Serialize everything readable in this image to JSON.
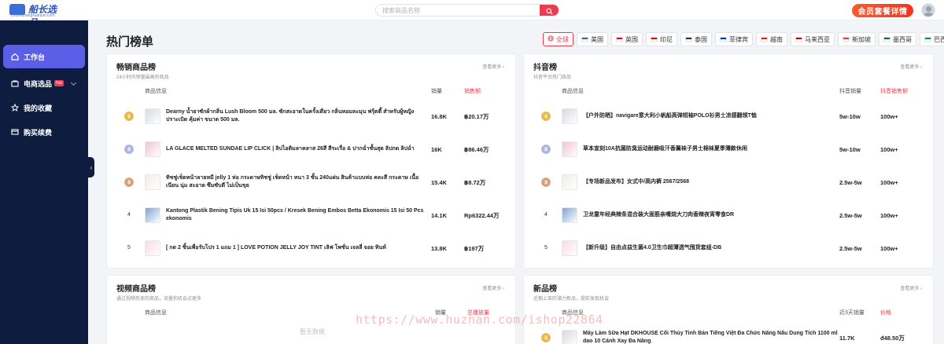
{
  "header": {
    "logo_text": "船长选品",
    "logo_sub": "chuanzhangxuanpin.com",
    "search_placeholder": "搜索商品名称",
    "vip_label": "会员套餐详情"
  },
  "sidebar": {
    "items": [
      {
        "label": "工作台",
        "icon": "home-icon"
      },
      {
        "label": "电商选品",
        "badge": "Hot",
        "icon": "store-icon"
      },
      {
        "label": "我的收藏",
        "icon": "star-icon"
      },
      {
        "label": "购买续费",
        "icon": "card-icon"
      }
    ],
    "collapse_glyph": "‹"
  },
  "page": {
    "title": "热门榜单"
  },
  "regions": [
    {
      "label": "全球",
      "active": true,
      "color": "#888888"
    },
    {
      "label": "美国",
      "color": "#3c5aa6"
    },
    {
      "label": "英国",
      "color": "#c8102e"
    },
    {
      "label": "印尼",
      "color": "#e00000"
    },
    {
      "label": "泰国",
      "color": "#2d2a4a"
    },
    {
      "label": "菲律宾",
      "color": "#0038a8"
    },
    {
      "label": "越南",
      "color": "#da251d"
    },
    {
      "label": "马来西亚",
      "color": "#cc0001"
    },
    {
      "label": "新加坡",
      "color": "#ef3340"
    },
    {
      "label": "墨西哥",
      "color": "#006847"
    },
    {
      "label": "巴西",
      "color": "#009c3b"
    }
  ],
  "panels": {
    "bestsellers": {
      "title": "畅销商品榜",
      "subtitle": "24小时内销量最高的商品",
      "more": "查看更多 ›",
      "col_info": "商品信息",
      "col_sales": "销量",
      "col_revenue": "销售额",
      "rows": [
        {
          "rank": "1",
          "name": "Dearny น้ำยาซักผ้ากลิ่น Lush Bloom 500 มล. ซักสะอาดในครั้งเดียว กลิ่นหอมละมุน ฟรุ้ตตี้ สำหรับผู้หญิง ปราะเบิด คุ้มค่า ขนาด 500 มล.",
          "sales": "16.8K",
          "revenue": "฿20.17万"
        },
        {
          "rank": "2",
          "name": "LA GLACE MELTED SUNDAE LIP CLICK | ลิปไอติมลาคลาส 26สี สีระเรื่อ & ปากฉ่ำชั้นสุด ลิปกด ลิปฉ่ำ",
          "sales": "16K",
          "revenue": "฿86.46万"
        },
        {
          "rank": "3",
          "name": "ทิชชู่เช็ดหน้าลายหมี jelly 1 ห่อ กระดาษทิชชู่ เช็ดหน้า หนา 3 ชั้น 240แผ่น สินค้าแบบห่อ คละสี กระดาษ เนื้อเนียน นุ่ม สะอาด ซึมซับดี ไม่เป็นขุย",
          "sales": "15.4K",
          "revenue": "฿8.72万"
        },
        {
          "rank": "4",
          "name": "Kantong Plastik Bening Tipis Uk 15 Isi 50pcs / Kresek Bening Embos Betta Ekonomis 15 Isi 50 Pcs ekonomis",
          "sales": "14.1K",
          "revenue": "Rp6322.44万"
        },
        {
          "rank": "5",
          "name": "[ กด 2 ชิ้นเพื่อรับโปร 1 แถม 1 ] LOVE POTION JELLY JOY TINT เลิฟ โพชั่น เจลลี่ จอย ทินท์",
          "sales": "13.8K",
          "revenue": "฿197万"
        }
      ]
    },
    "douyin": {
      "title": "抖音榜",
      "subtitle": "抖音平台热门商品",
      "more": "查看更多 ›",
      "col_info": "商品信息",
      "col_sales": "抖音销量",
      "col_revenue": "抖音销售额",
      "rows": [
        {
          "rank": "1",
          "name": "【户外防晒】navigare意大利小帆船高弹短袖POLO衫男士凉感翻领T恤",
          "sales": "5w-10w",
          "revenue": "100w+"
        },
        {
          "rank": "2",
          "name": "草本宣刻10A抗菌防臭运动耐磨吸汗香薰袜子男士棉袜夏季薄款休闲",
          "sales": "5w-10w",
          "revenue": "100w+"
        },
        {
          "rank": "3",
          "name": "【专场新品发布】女式中/高内裤 2567/2568",
          "sales": "2.5w-5w",
          "revenue": "100w+"
        },
        {
          "rank": "4",
          "name": "卫龙童年经典辣条混合装大面筋亲嘴烧大刀肉香辣夜宵零食DR",
          "sales": "2.5w-5w",
          "revenue": "100w+"
        },
        {
          "rank": "5",
          "name": "【新升级】自由点益生菌4.0卫生巾超薄透气囤货套组-DB",
          "sales": "2.5w-5w",
          "revenue": "100w+"
        }
      ]
    },
    "video": {
      "title": "视频商品榜",
      "subtitle": "通过视频热卖的商品，流量和机会点更多",
      "more": "查看更多 ›",
      "col_info": "商品信息",
      "col_sales": "销量",
      "col_revenue": "总播放量",
      "empty": "暂无数据"
    },
    "newitems": {
      "title": "新品榜",
      "subtitle": "近期上架的潜力新品，提前发现机会",
      "more": "查看更多 ›",
      "col_info": "商品信息",
      "col_sales": "近3天销量",
      "col_revenue": "价格",
      "rows": [
        {
          "rank": "1",
          "name": "Máy Làm Sữa Hạt DKHOUSE Cối Thủy Tinh Bản Tiếng Việt Đa Chức Năng Nấu Dung Tích 1100 ml dao 10 Cánh Xay Đa Năng",
          "sales": "11.7K",
          "revenue": "đ48.50万"
        }
      ]
    }
  },
  "watermark": "https://www.huzhan.com/ishop22864"
}
